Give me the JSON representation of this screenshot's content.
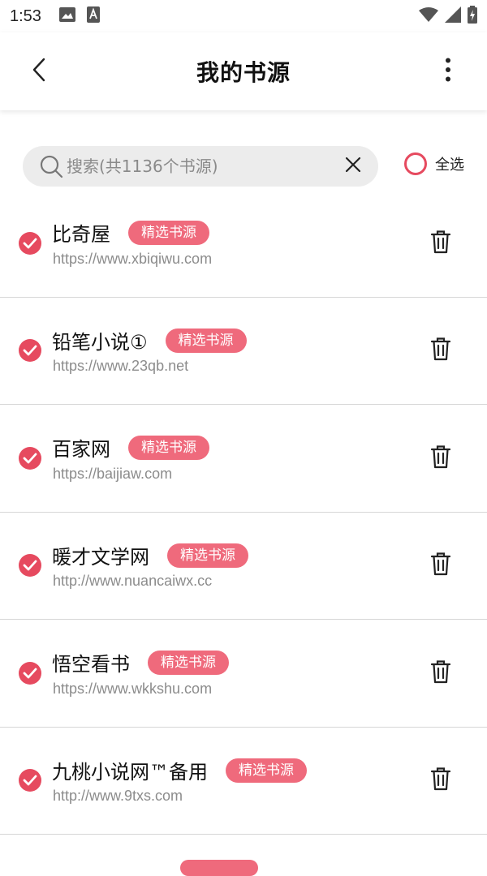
{
  "status": {
    "time": "1:53"
  },
  "appbar": {
    "title": "我的书源"
  },
  "search": {
    "placeholder": "搜索(共1136个书源)"
  },
  "select_all": {
    "label": "全选"
  },
  "accent_color": "#e64a5f",
  "sources": [
    {
      "name": "比奇屋",
      "tag": "精选书源",
      "url": "https://www.xbiqiwu.com",
      "checked": true
    },
    {
      "name": "铅笔小说①",
      "tag": "精选书源",
      "url": "https://www.23qb.net",
      "checked": true
    },
    {
      "name": "百家网",
      "tag": "精选书源",
      "url": "https://baijiaw.com",
      "checked": true
    },
    {
      "name": "暖才文学网",
      "tag": "精选书源",
      "url": "http://www.nuancaiwx.cc",
      "checked": true
    },
    {
      "name": "悟空看书",
      "tag": "精选书源",
      "url": "https://www.wkkshu.com",
      "checked": true
    },
    {
      "name": "九桃小说网™备用",
      "tag": "精选书源",
      "url": "http://www.9txs.com",
      "checked": true
    }
  ],
  "icons": {
    "back": "chevron-left-icon",
    "more": "more-vertical-icon",
    "search": "search-icon",
    "clear": "close-icon",
    "check": "check-circle-icon",
    "delete": "trash-icon"
  }
}
